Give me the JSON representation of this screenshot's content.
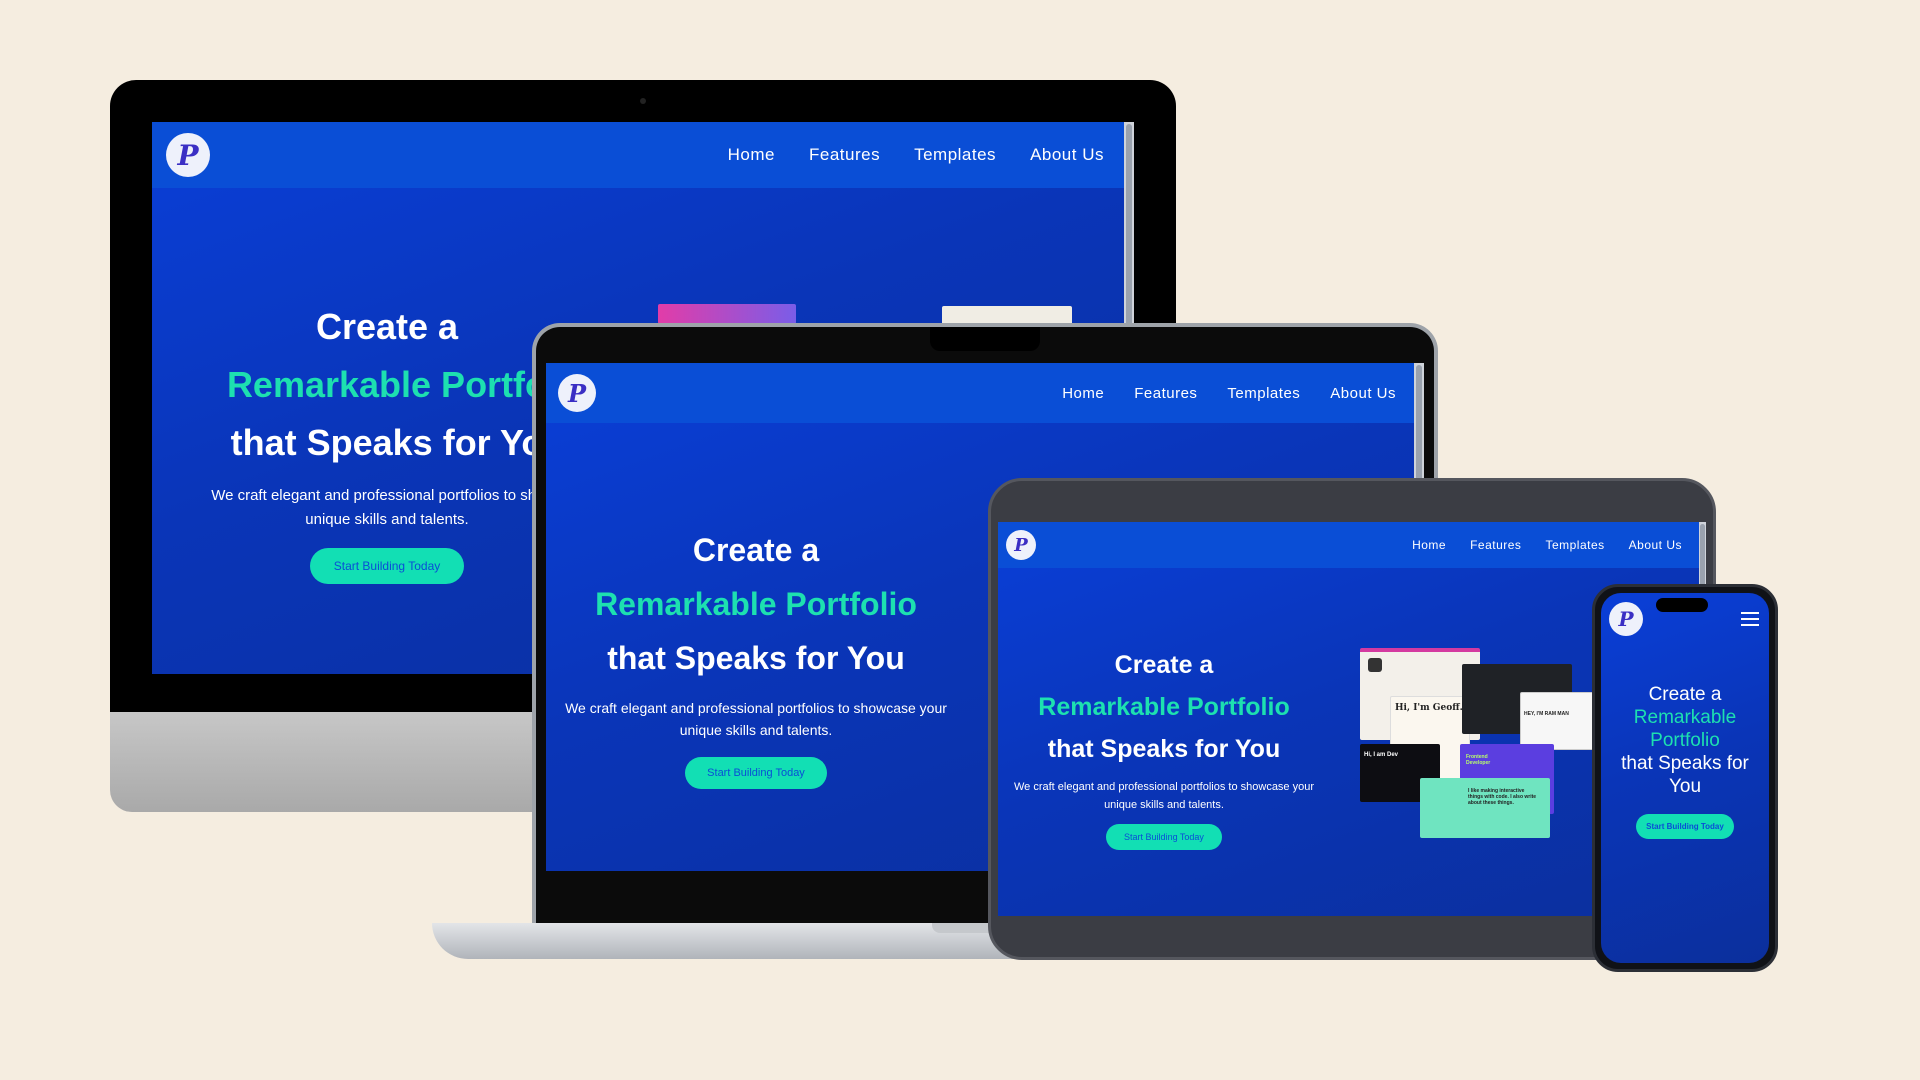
{
  "brand": {
    "logo_letter": "P"
  },
  "nav": {
    "items": [
      "Home",
      "Features",
      "Templates",
      "About Us"
    ]
  },
  "hero": {
    "line1": "Create a",
    "line2": "Remarkable Portfolio",
    "line3": "that Speaks for You",
    "description": "We craft elegant and professional portfolios to showcase your unique skills and talents.",
    "cta": "Start Building Today"
  },
  "imac_hero": {
    "line2": "Remarkable Portfo",
    "line3": "that Speaks for Yo",
    "description_l1": "We craft elegant and professional portfolios to showc",
    "description_l2": "unique skills and talents."
  },
  "mobile_hero": {
    "line1": "Create a",
    "line2a": "Remarkable",
    "line2b": "Portfolio",
    "line3a": "that Speaks for",
    "line3b": "You"
  },
  "collage": {
    "thumb1": "Hi, I'm Geoff.",
    "thumb2": "HEY, I'M RAM MAN",
    "thumb3": "Hi, I am Dev",
    "thumb4": "Frontend Developer",
    "thumb5": "I like making interactive things with code. I also write about these things."
  },
  "colors": {
    "background": "#f5ede0",
    "nav": "#0a4ed6",
    "hero_bg": "#0a35b8",
    "accent": "#1de0b0",
    "cta_bg": "#12dfb4",
    "cta_text": "#0a4ed6"
  }
}
